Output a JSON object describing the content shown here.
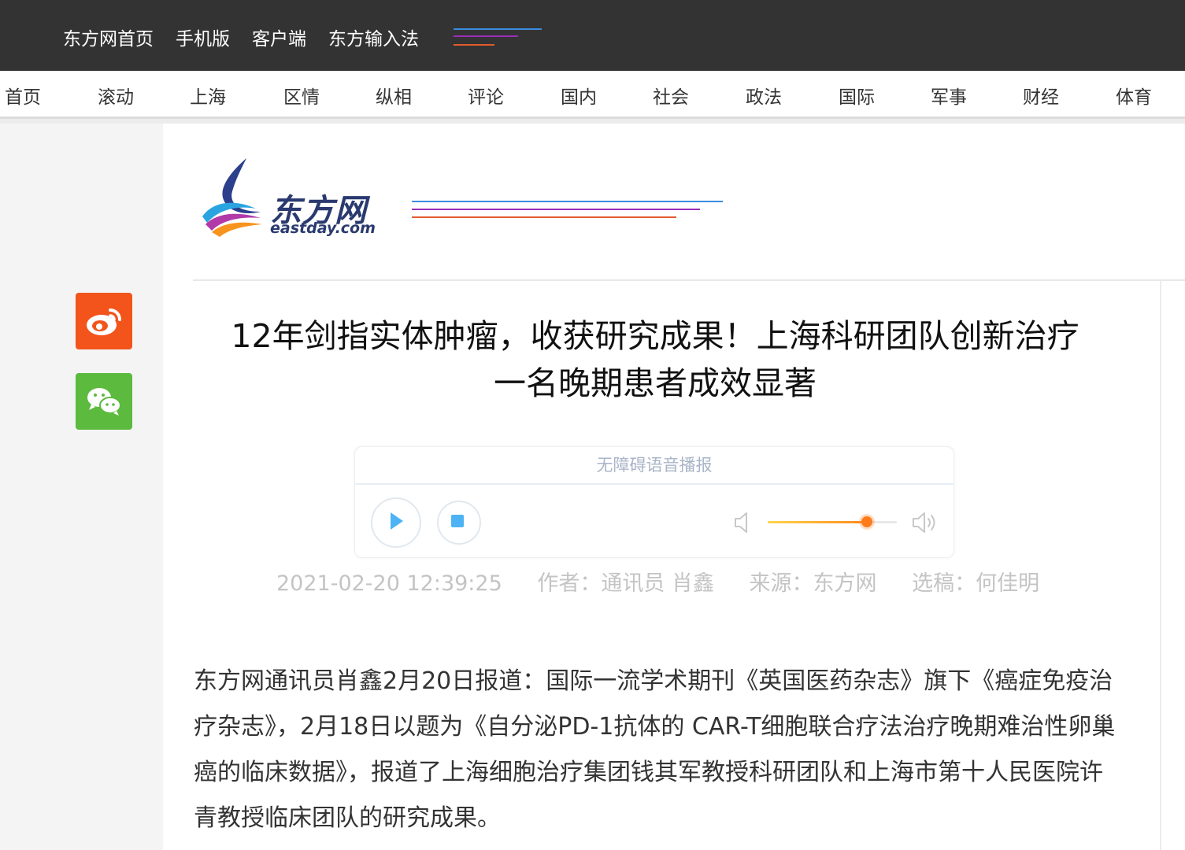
{
  "topnav": {
    "links": [
      "东方网首页",
      "手机版",
      "客户端",
      "东方输入法"
    ],
    "lines_colors": [
      "#3b8de0",
      "#9c2fb8",
      "#e25b2b"
    ]
  },
  "catnav": {
    "items": [
      "首页",
      "滚动",
      "上海",
      "区情",
      "纵相",
      "评论",
      "国内",
      "社会",
      "政法",
      "国际",
      "军事",
      "财经",
      "体育"
    ]
  },
  "share": {
    "icons": [
      "weibo-icon",
      "wechat-icon"
    ]
  },
  "logo": {
    "brand": "东方网",
    "domain": "eastday.com"
  },
  "article": {
    "title": "12年剑指实体肿瘤，收获研究成果！上海科研团队创新治疗一名晚期患者成效显著",
    "datetime": "2021-02-20 12:39:25",
    "author": "作者：通讯员 肖鑫",
    "source": "来源：东方网",
    "editor": "选稿：何佳明",
    "paragraph": "东方网通讯员肖鑫2月20日报道：国际一流学术期刊《英国医药杂志》旗下《癌症免疫治疗杂志》，2月18日以题为《自分泌PD-1抗体的 CAR-T细胞联合疗法治疗晚期难治性卵巢癌的临床数据》，报道了上海细胞治疗集团钱其军教授科研团队和上海市第十人民医院许青教授临床团队的研究成果。"
  },
  "player": {
    "title": "无障碍语音播报",
    "volume_level": 0.77,
    "accent": "#ff7a1a",
    "button_color": "#4db3f5"
  }
}
